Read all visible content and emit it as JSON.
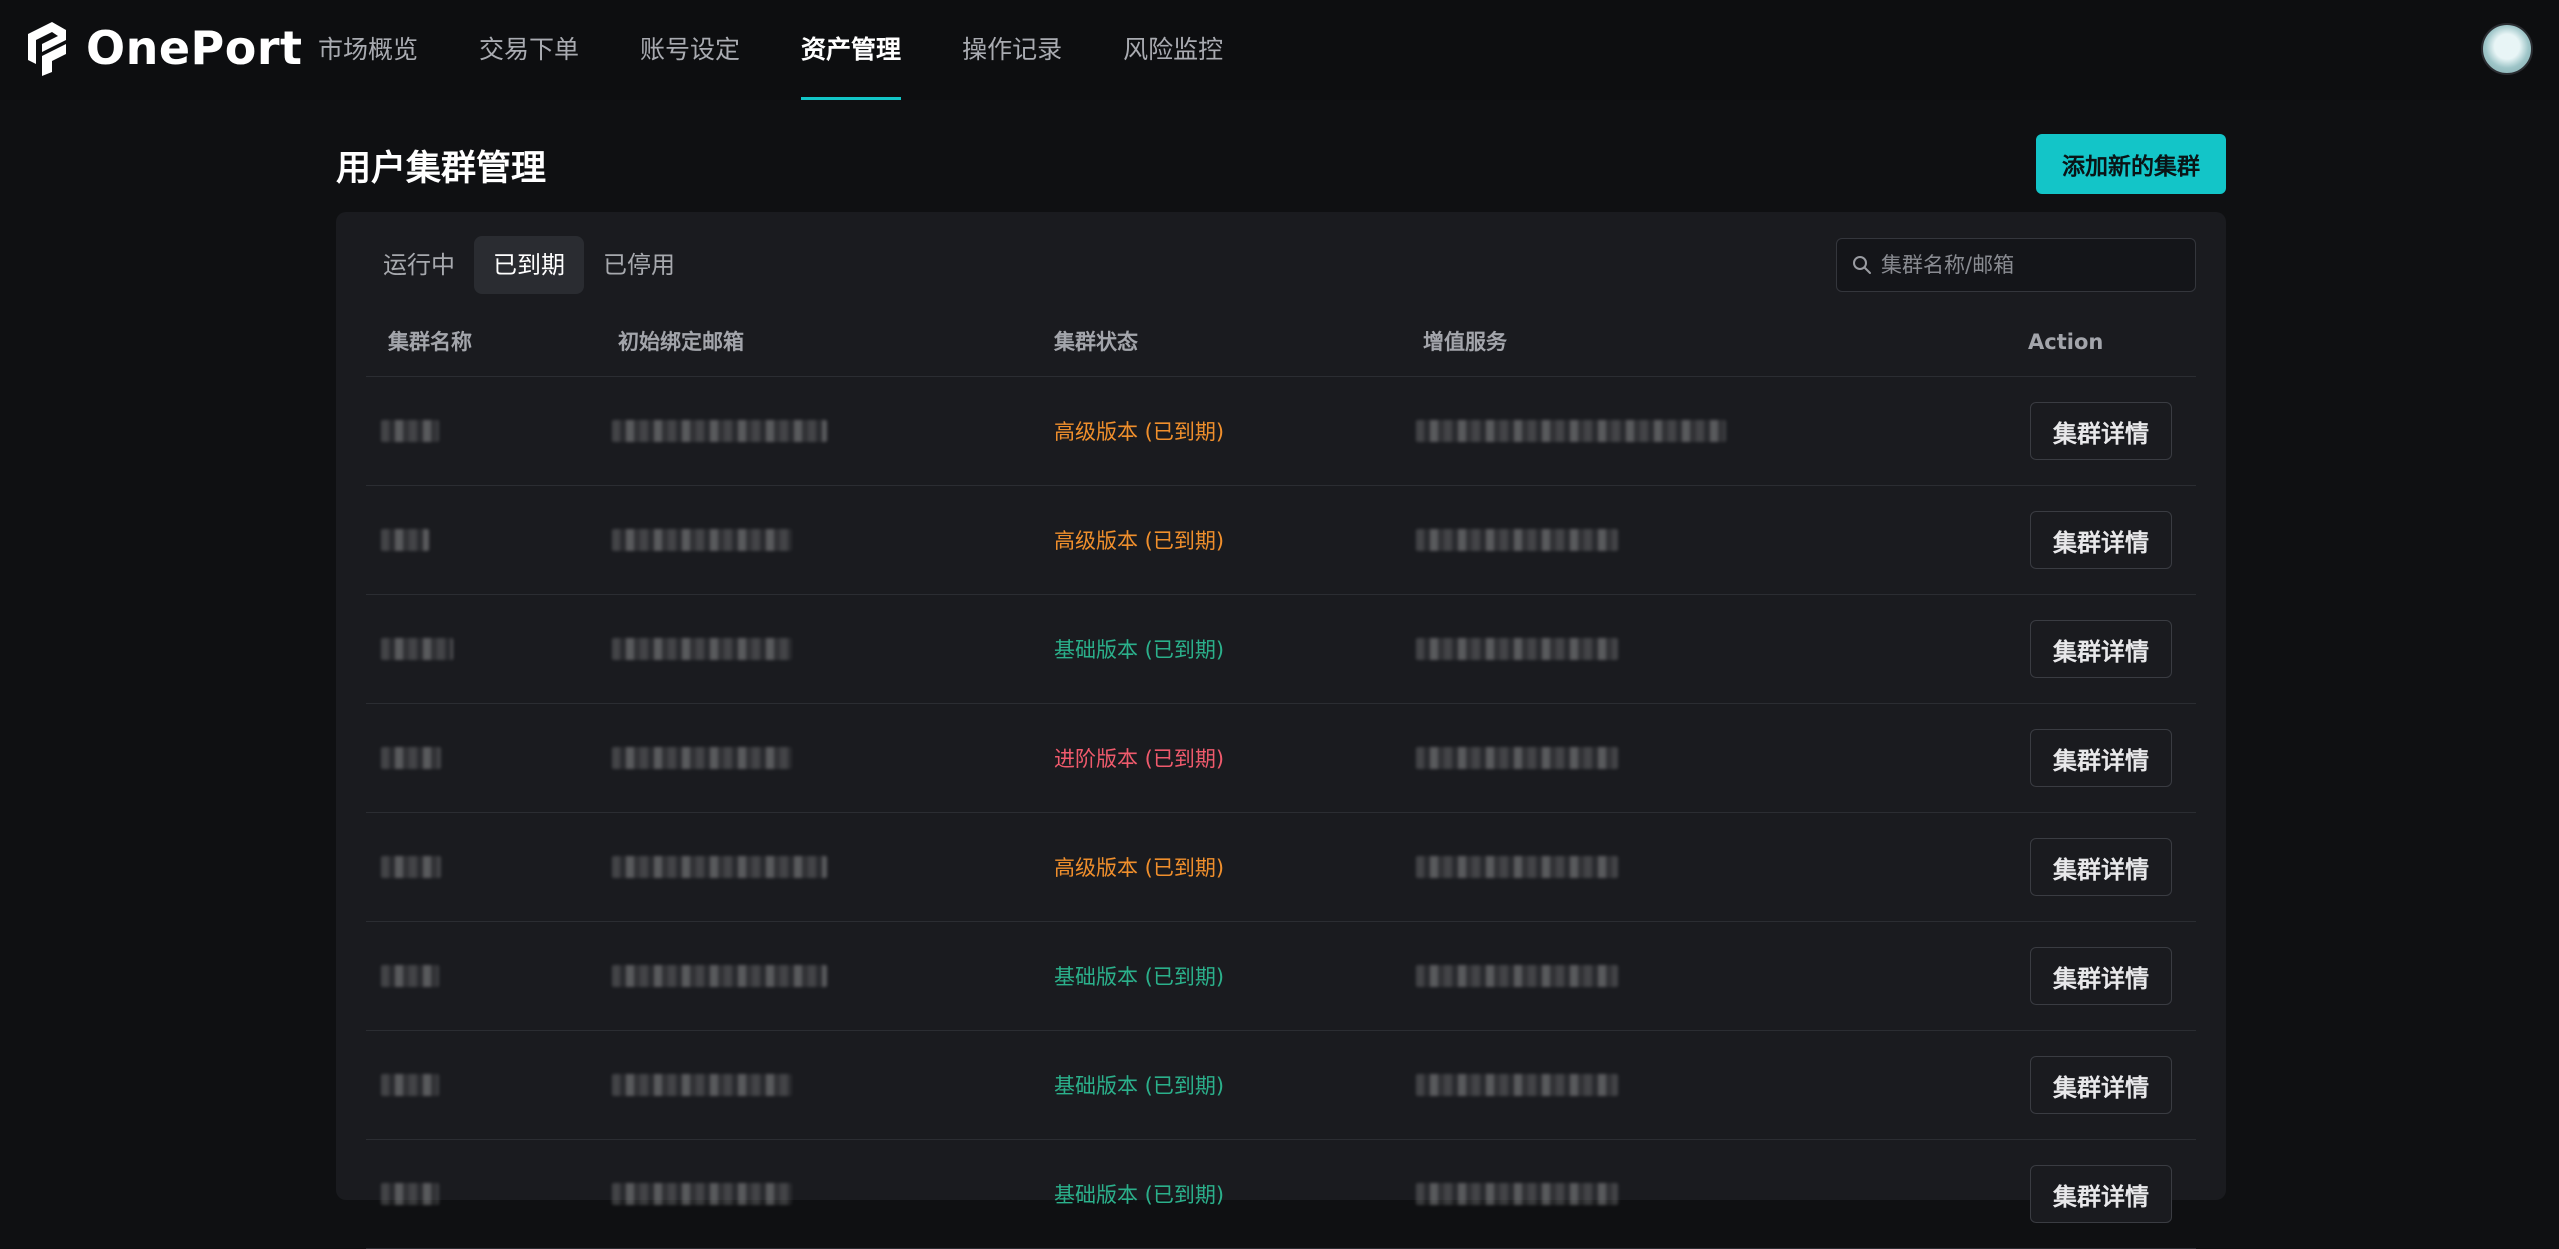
{
  "brand": {
    "name": "OnePort",
    "accent": "#13c5c8"
  },
  "nav": {
    "items": [
      {
        "label": "市场概览"
      },
      {
        "label": "交易下单"
      },
      {
        "label": "账号设定"
      },
      {
        "label": "资产管理"
      },
      {
        "label": "操作记录"
      },
      {
        "label": "风险监控"
      }
    ],
    "active": "资产管理"
  },
  "page": {
    "title": "用户集群管理",
    "add_button": "添加新的集群"
  },
  "tabs": {
    "items": [
      {
        "label": "运行中"
      },
      {
        "label": "已到期"
      },
      {
        "label": "已停用"
      }
    ],
    "active": "已到期"
  },
  "search": {
    "placeholder": "集群名称/邮箱",
    "value": ""
  },
  "table": {
    "headers": {
      "name": "集群名称",
      "email": "初始绑定邮箱",
      "status": "集群状态",
      "service": "增值服务",
      "action": "Action"
    },
    "rows": [
      {
        "status": "高级版本 (已到期)",
        "status_type": "high",
        "action": "集群详情"
      },
      {
        "status": "高级版本 (已到期)",
        "status_type": "high",
        "action": "集群详情"
      },
      {
        "status": "基础版本 (已到期)",
        "status_type": "basic",
        "action": "集群详情"
      },
      {
        "status": "进阶版本 (已到期)",
        "status_type": "adv",
        "action": "集群详情"
      },
      {
        "status": "高级版本 (已到期)",
        "status_type": "high",
        "action": "集群详情"
      },
      {
        "status": "基础版本 (已到期)",
        "status_type": "basic",
        "action": "集群详情"
      },
      {
        "status": "基础版本 (已到期)",
        "status_type": "basic",
        "action": "集群详情"
      },
      {
        "status": "基础版本 (已到期)",
        "status_type": "basic",
        "action": "集群详情"
      }
    ]
  },
  "colors": {
    "high": "#f08f2c",
    "basic": "#2bb08b",
    "advanced": "#ef5a6c"
  }
}
